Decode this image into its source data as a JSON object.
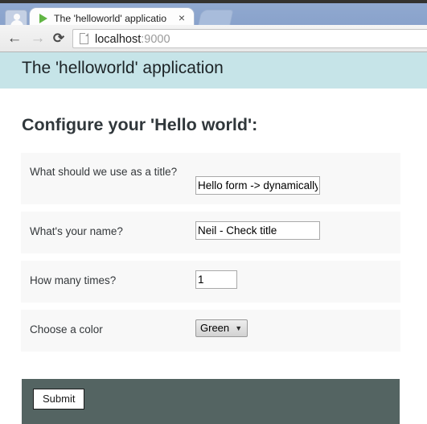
{
  "browser": {
    "profile_icon": "person-icon",
    "tab": {
      "favicon": "play-triangle-icon",
      "title": "The 'helloworld' applicatio",
      "close_label": "×"
    },
    "new_tab_label": "",
    "nav": {
      "back_label": "←",
      "forward_label": "→",
      "reload_label": "⟳"
    },
    "omnibox": {
      "host": "localhost",
      "port": ":9000"
    }
  },
  "page": {
    "banner_title": "The 'helloworld' application",
    "heading": "Configure your 'Hello world':",
    "colors": {
      "banner": "#c6e4e8",
      "row": "#f8f8f8",
      "footer": "#546462"
    },
    "form": {
      "rows": [
        {
          "label": "What should we use as a title?",
          "type": "text",
          "value": "Hello form -> dynamically"
        },
        {
          "label": "What's your name?",
          "type": "text",
          "value": "Neil - Check title"
        },
        {
          "label": "How many times?",
          "type": "text",
          "value": "1"
        },
        {
          "label": "Choose a color",
          "type": "select",
          "value": "Green",
          "arrow": "▼"
        }
      ],
      "submit_label": "Submit"
    }
  }
}
